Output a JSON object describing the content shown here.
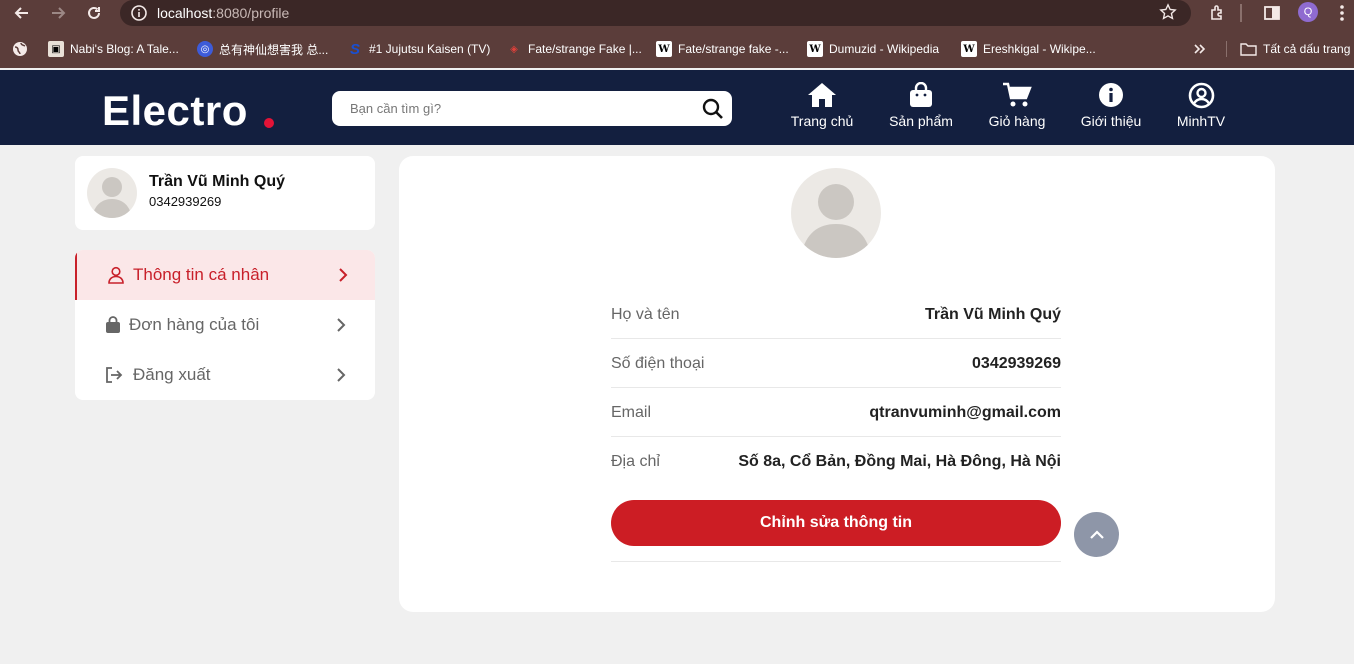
{
  "browser": {
    "url_host": "localhost",
    "url_path": ":8080/profile",
    "profile_initial": "Q",
    "bookmarks": [
      {
        "label": "Nabi's Blog: A Tale...",
        "icon": "blog-favicon"
      },
      {
        "label": "总有神仙想害我 总...",
        "icon": "globe-favicon"
      },
      {
        "label": "#1 Jujutsu Kaisen (TV)",
        "icon": "s-favicon"
      },
      {
        "label": "Fate/strange Fake |...",
        "icon": "red-favicon"
      },
      {
        "label": "Fate/strange fake -...",
        "icon": "wikipedia-favicon"
      },
      {
        "label": "Dumuzid - Wikipedia",
        "icon": "wikipedia-favicon"
      },
      {
        "label": "Ereshkigal - Wikipe...",
        "icon": "wikipedia-favicon"
      }
    ],
    "all_bookmarks": "Tất cả dấu trang"
  },
  "header": {
    "logo": "Electro",
    "search_placeholder": "Bạn cần tìm gì?",
    "nav": [
      {
        "label": "Trang chủ",
        "icon": "home-icon"
      },
      {
        "label": "Sản phẩm",
        "icon": "shopping-bag-icon"
      },
      {
        "label": "Giỏ hàng",
        "icon": "cart-icon"
      },
      {
        "label": "Giới thiệu",
        "icon": "info-icon"
      },
      {
        "label": "MinhTV",
        "icon": "user-circle-icon"
      }
    ]
  },
  "sidebar": {
    "user_name": "Trần Vũ Minh Quý",
    "user_phone": "0342939269",
    "menu": [
      {
        "label": "Thông tin cá nhân",
        "icon": "user-icon",
        "active": true
      },
      {
        "label": "Đơn hàng của tôi",
        "icon": "bag-icon",
        "active": false
      },
      {
        "label": "Đăng xuất",
        "icon": "logout-icon",
        "active": false
      }
    ]
  },
  "profile": {
    "fields": [
      {
        "label": "Họ và tên",
        "value": "Trần Vũ Minh Quý"
      },
      {
        "label": "Số điện thoại",
        "value": "0342939269"
      },
      {
        "label": "Email",
        "value": "qtranvuminh@gmail.com"
      },
      {
        "label": "Địa chỉ",
        "value": "Số 8a, Cổ Bản, Đồng Mai, Hà Đông, Hà Nội"
      }
    ],
    "edit_button": "Chỉnh sửa thông tin"
  },
  "colors": {
    "header_bg": "#131f3f",
    "accent": "#cc1d24",
    "browser_bg": "#5b3d3a"
  }
}
